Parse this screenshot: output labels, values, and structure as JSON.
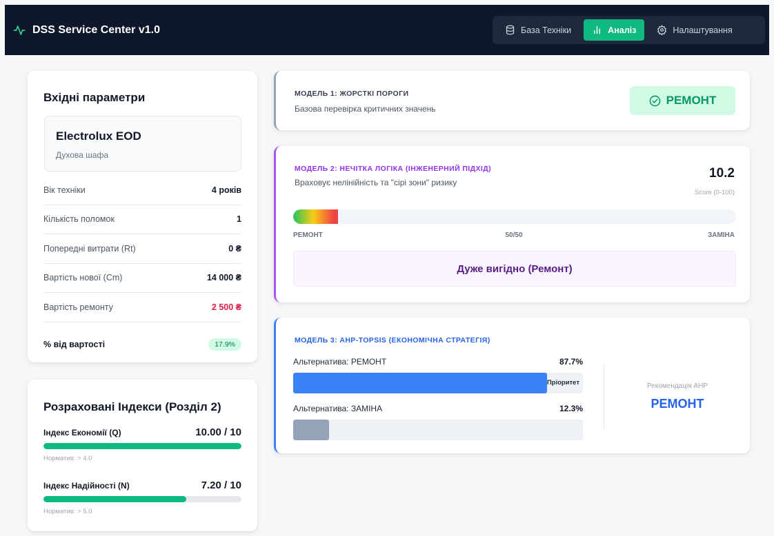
{
  "header": {
    "title": "DSS Service Center v1.0",
    "nav": [
      {
        "label": "База Техніки",
        "icon": "database-icon",
        "active": false
      },
      {
        "label": "Аналіз",
        "icon": "bar-chart-icon",
        "active": true
      },
      {
        "label": "Налаштування",
        "icon": "gear-icon",
        "active": false
      }
    ]
  },
  "inputs": {
    "title": "Вхідні параметри",
    "device_name": "Electrolux EOD",
    "device_type": "Духова шафа",
    "params": [
      {
        "label": "Вік техніки",
        "value": "4 років"
      },
      {
        "label": "Кількість поломок",
        "value": "1"
      },
      {
        "label": "Попередні витрати (Rt)",
        "value": "0 ₴"
      },
      {
        "label": "Вартість нової (Cm)",
        "value": "14 000 ₴"
      },
      {
        "label": "Вартість ремонту",
        "value": "2 500 ₴"
      }
    ],
    "percent_label": "% від вартості",
    "percent_value": "17.9%"
  },
  "indices": {
    "title": "Розраховані Індекси (Розділ 2)",
    "items": [
      {
        "label": "Індекс Економії (Q)",
        "value": "10.00 / 10",
        "fraction": 1.0,
        "norm": "Норматив: > 4.0"
      },
      {
        "label": "Індекс Надійності (N)",
        "value": "7.20 / 10",
        "fraction": 0.72,
        "norm": "Норматив: > 5.0"
      }
    ]
  },
  "model1": {
    "title": "МОДЕЛЬ 1: ЖОРСТКІ ПОРОГИ",
    "subtitle": "Базова перевірка критичних значень",
    "result": "РЕМОНТ"
  },
  "model2": {
    "title": "МОДЕЛЬ 2: НЕЧІТКА ЛОГІКА (ІНЖЕНЕРНИЙ ПІДХІД)",
    "subtitle": "Враховує нелінійність та \"сірі зони\" ризику",
    "score": "10.2",
    "score_caption": "Score (0-100)",
    "score_fraction": 0.102,
    "scale_left": "РЕМОНТ",
    "scale_mid": "50/50",
    "scale_right": "ЗАМІНА",
    "verdict": "Дуже вигідно (Ремонт)"
  },
  "model3": {
    "title": "МОДЕЛЬ 3: AHP-TOPSIS (ЕКОНОМІЧНА СТРАТЕГІЯ)",
    "alternatives": [
      {
        "label": "Альтернатива: РЕМОНТ",
        "percent": "87.7%",
        "fraction": 0.877,
        "tag": "Пріоритет",
        "color": "#3b82f6"
      },
      {
        "label": "Альтернатива: ЗАМІНА",
        "percent": "12.3%",
        "fraction": 0.123,
        "tag": "",
        "color": "#94a3b8"
      }
    ],
    "recommendation_caption": "Рекомендація AHP",
    "recommendation": "РЕМОНТ"
  },
  "colors": {
    "header_bg": "#0f172a",
    "accent_green": "#10b981",
    "accent_purple": "#a855f7",
    "accent_blue": "#3b82f6",
    "danger": "#e11d48"
  }
}
